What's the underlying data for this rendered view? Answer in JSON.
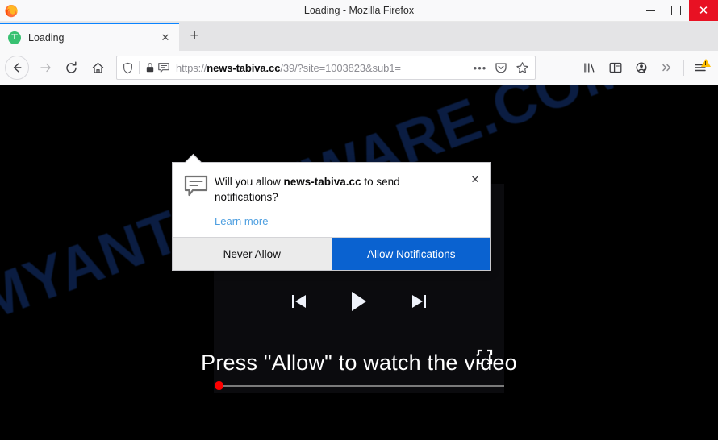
{
  "window": {
    "title": "Loading - Mozilla Firefox",
    "logo_icon": "firefox-logo-icon",
    "controls": {
      "minimize_label": "—",
      "minimize_icon": "minimize-icon",
      "maximize_label": "□",
      "maximize_icon": "maximize-icon",
      "close_label": "✕",
      "close_icon": "close-icon"
    }
  },
  "tabstrip": {
    "tabs": [
      {
        "title": "Loading",
        "favicon_icon": "loading-favicon-icon",
        "favicon_letter": "T",
        "close_label": "✕"
      }
    ],
    "newtab_label": "+",
    "newtab_icon": "new-tab-icon"
  },
  "navbar": {
    "back_icon": "back-arrow-icon",
    "back_label": "←",
    "forward_icon": "forward-arrow-icon",
    "forward_label": "→",
    "reload_icon": "reload-icon",
    "home_icon": "home-icon",
    "urlbar": {
      "shield_icon": "tracking-protection-shield-icon",
      "lock_icon": "padlock-icon",
      "notification_icon": "notification-bubble-icon",
      "scheme": "https://",
      "host": "news-tabiva.cc",
      "path": "/39/?site=1003823&sub1=",
      "full_url": "https://news-tabiva.cc/39/?site=1003823&sub1=",
      "page_actions_icon": "page-actions-ellipsis-icon",
      "page_actions_label": "•••",
      "pocket_icon": "pocket-icon",
      "bookmark_icon": "bookmark-star-icon"
    },
    "right_buttons": [
      {
        "icon": "library-icon",
        "name": "library-button"
      },
      {
        "icon": "sidebar-icon",
        "name": "sidebar-button"
      },
      {
        "icon": "account-icon",
        "name": "account-button"
      },
      {
        "icon": "overflow-chevrons-icon",
        "name": "overflow-button",
        "label": "»"
      }
    ],
    "menu_icon": "hamburger-menu-icon",
    "menu_badge_icon": "warning-triangle-icon"
  },
  "doorhanger": {
    "icon": "notification-bubble-icon",
    "question_prefix": "Will you allow ",
    "question_host": "news-tabiva.cc",
    "question_suffix": " to send notifications?",
    "learn_more_label": "Learn more",
    "close_label": "✕",
    "close_icon": "close-icon",
    "never_allow": {
      "pre": "Ne",
      "key": "v",
      "post": "er Allow",
      "label": "Never Allow"
    },
    "allow": {
      "pre": "",
      "key": "A",
      "post": "llow Notifications",
      "label": "Allow Notifications"
    }
  },
  "page": {
    "watermark": "MYANTISPYWARE.COM",
    "headline": "Press \"Allow\" to watch the video",
    "player": {
      "prev_icon": "skip-previous-icon",
      "play_icon": "play-icon",
      "next_icon": "skip-next-icon",
      "fullscreen_icon": "fullscreen-icon",
      "progress_percent": 0,
      "scrubber_icon": "progress-handle-icon"
    }
  },
  "colors": {
    "accent_blue": "#0a62d0",
    "tab_highlight": "#0a84ff",
    "close_red": "#e81123",
    "watermark_blue": "#12306b",
    "progress_red": "#fe0000",
    "favicon_green": "#38c172",
    "link_blue": "#4e9fe0"
  }
}
